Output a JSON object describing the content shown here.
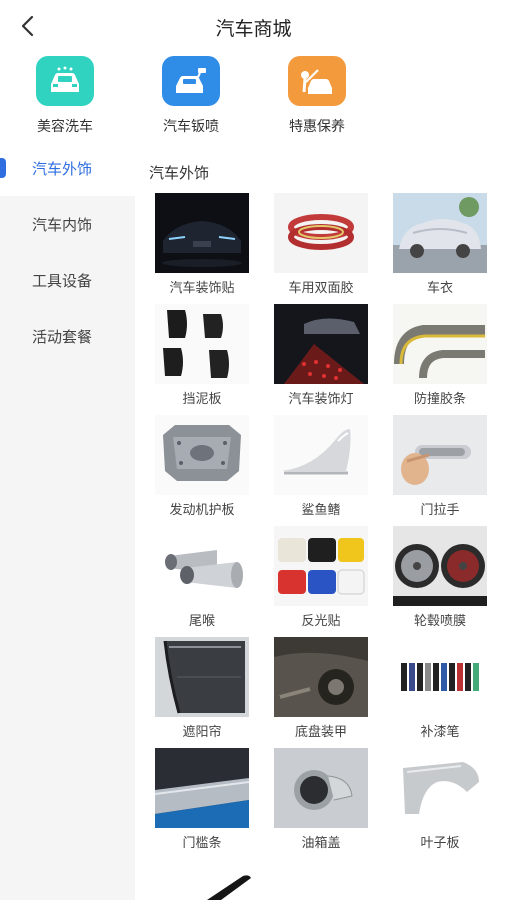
{
  "header": {
    "title": "汽车商城"
  },
  "services": [
    {
      "label": "美容洗车",
      "icon": "car-wash-icon",
      "color": "#2fd3c0"
    },
    {
      "label": "汽车钣喷",
      "icon": "car-spray-icon",
      "color": "#2f8de8"
    },
    {
      "label": "特惠保养",
      "icon": "car-maintenance-icon",
      "color": "#f39a3c"
    }
  ],
  "sidebar": {
    "items": [
      {
        "label": "汽车外饰"
      },
      {
        "label": "汽车内饰"
      },
      {
        "label": "工具设备"
      },
      {
        "label": "活动套餐"
      }
    ]
  },
  "content": {
    "section_title": "汽车外饰",
    "products": [
      {
        "name": "汽车装饰贴"
      },
      {
        "name": "车用双面胶"
      },
      {
        "name": "车衣"
      },
      {
        "name": "挡泥板"
      },
      {
        "name": "汽车装饰灯"
      },
      {
        "name": "防撞胶条"
      },
      {
        "name": "发动机护板"
      },
      {
        "name": "鲨鱼鳍"
      },
      {
        "name": "门拉手"
      },
      {
        "name": "尾喉"
      },
      {
        "name": "反光贴"
      },
      {
        "name": "轮毂喷膜"
      },
      {
        "name": "遮阳帘"
      },
      {
        "name": "底盘装甲"
      },
      {
        "name": "补漆笔"
      },
      {
        "name": "门槛条"
      },
      {
        "name": "油箱盖"
      },
      {
        "name": "叶子板"
      }
    ]
  },
  "colors": {
    "accent": "#2f6ee0",
    "sidebar_bg": "#f5f5f5"
  }
}
